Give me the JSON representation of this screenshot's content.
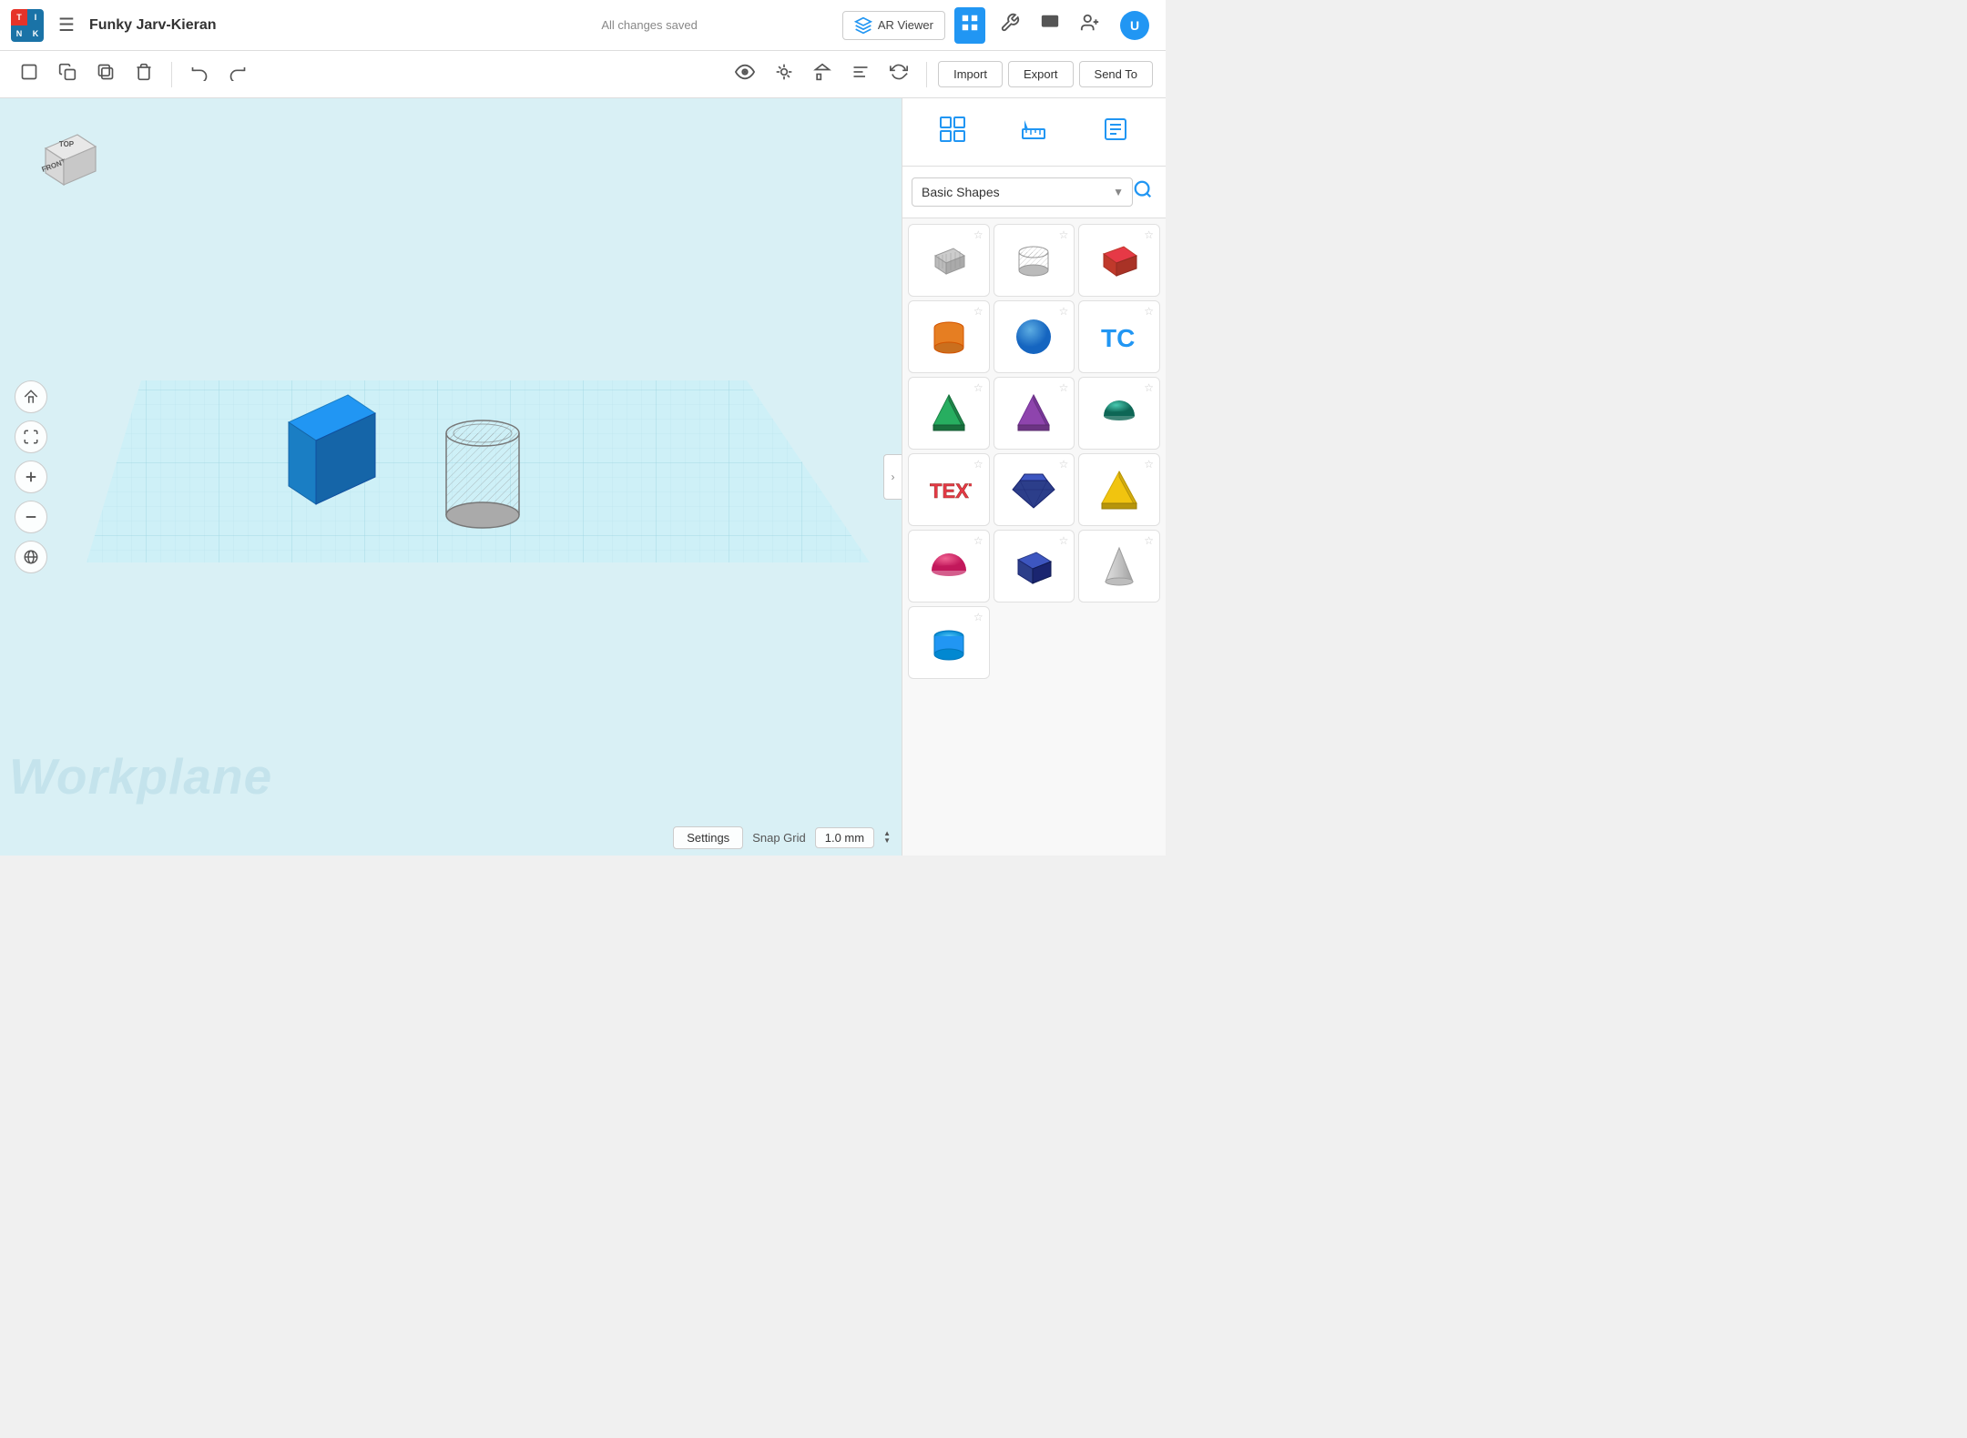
{
  "app": {
    "logo": {
      "cells": [
        "T",
        "I",
        "N",
        "K"
      ]
    },
    "title": "Funky Jarv-Kieran",
    "saved_status": "All changes saved"
  },
  "navbar": {
    "ar_viewer_label": "AR Viewer",
    "import_label": "Import",
    "export_label": "Export",
    "sendto_label": "Send To"
  },
  "toolbar": {
    "import_label": "Import",
    "export_label": "Export",
    "sendto_label": "Send To"
  },
  "viewport": {
    "workplane_label": "Workplane"
  },
  "view_cube": {
    "top_label": "TOP",
    "front_label": "FRONT"
  },
  "bottom_bar": {
    "settings_label": "Settings",
    "snap_grid_label": "Snap Grid",
    "snap_value": "1.0 mm"
  },
  "right_panel": {
    "shape_category": "Basic Shapes",
    "shapes": [
      {
        "name": "hole-box",
        "color": "#aaa",
        "type": "hole-box"
      },
      {
        "name": "hole-cylinder",
        "color": "#aaa",
        "type": "hole-cylinder"
      },
      {
        "name": "box",
        "color": "#cc2222",
        "type": "box"
      },
      {
        "name": "cylinder",
        "color": "#e67e22",
        "type": "cylinder"
      },
      {
        "name": "sphere",
        "color": "#2196f3",
        "type": "sphere"
      },
      {
        "name": "text-3d",
        "color": "#cc2222",
        "type": "text3d"
      },
      {
        "name": "pyramid-green",
        "color": "#27ae60",
        "type": "pyramid-green"
      },
      {
        "name": "pyramid-purple",
        "color": "#8e44ad",
        "type": "pyramid-purple"
      },
      {
        "name": "half-sphere-teal",
        "color": "#1abc9c",
        "type": "half-sphere"
      },
      {
        "name": "text-shape",
        "color": "#cc2222",
        "type": "text-red"
      },
      {
        "name": "gem",
        "color": "#2c3e8a",
        "type": "gem"
      },
      {
        "name": "pyramid-yellow",
        "color": "#f1c40f",
        "type": "pyramid-yellow"
      },
      {
        "name": "half-sphere-pink",
        "color": "#e91e8c",
        "type": "half-sphere-pink"
      },
      {
        "name": "box-blue",
        "color": "#2c3e8a",
        "type": "box-blue"
      },
      {
        "name": "cone-gray",
        "color": "#bbb",
        "type": "cone"
      },
      {
        "name": "cylinder-bottom",
        "color": "#2196f3",
        "type": "cylinder-b"
      }
    ]
  }
}
